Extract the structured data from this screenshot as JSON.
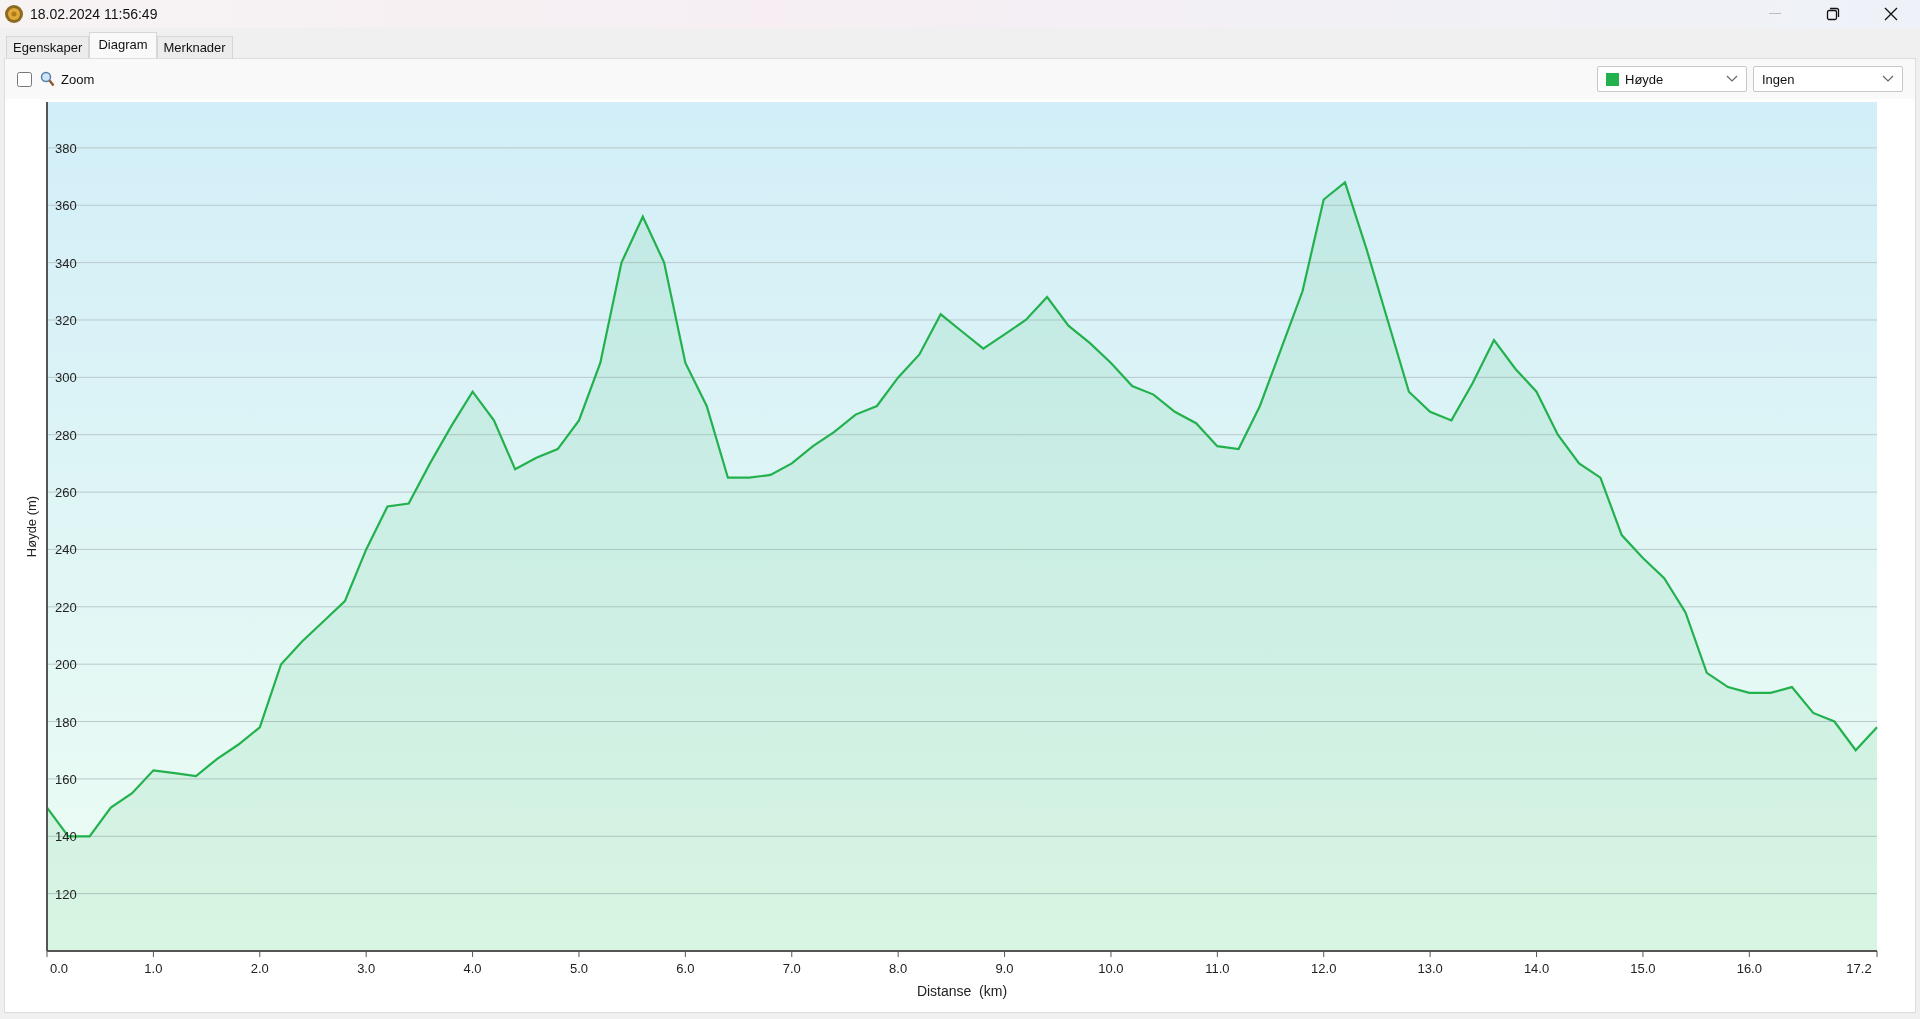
{
  "window": {
    "title": "18.02.2024 11:56:49"
  },
  "tabs": [
    {
      "label": "Egenskaper",
      "selected": false
    },
    {
      "label": "Diagram",
      "selected": true
    },
    {
      "label": "Merknader",
      "selected": false
    }
  ],
  "zoom": {
    "label": "Zoom",
    "checked": false
  },
  "selectors": [
    {
      "value": "Høyde",
      "color": "#22b14c"
    },
    {
      "value": "Ingen"
    }
  ],
  "chart": {
    "chart_data": {
      "type": "area",
      "xlabel": "Distanse  (km)",
      "ylabel": "Høyde (m)",
      "x": [
        0,
        0.2,
        0.4,
        0.6,
        0.8,
        1.0,
        1.2,
        1.4,
        1.6,
        1.8,
        2.0,
        2.2,
        2.4,
        2.6,
        2.8,
        3.0,
        3.2,
        3.4,
        3.6,
        3.8,
        4.0,
        4.2,
        4.4,
        4.6,
        4.8,
        5.0,
        5.2,
        5.4,
        5.6,
        5.8,
        6.0,
        6.2,
        6.4,
        6.6,
        6.8,
        7.0,
        7.2,
        7.4,
        7.6,
        7.8,
        8.0,
        8.2,
        8.4,
        8.6,
        8.8,
        9.0,
        9.2,
        9.4,
        9.6,
        9.8,
        10.0,
        10.2,
        10.4,
        10.6,
        10.8,
        11.0,
        11.2,
        11.4,
        11.6,
        11.8,
        12.0,
        12.2,
        12.4,
        12.6,
        12.8,
        13.0,
        13.2,
        13.4,
        13.6,
        13.8,
        14.0,
        14.2,
        14.4,
        14.6,
        14.8,
        15.0,
        15.2,
        15.4,
        15.6,
        15.8,
        16.0,
        16.2,
        16.4,
        16.6,
        16.8,
        17.0,
        17.2
      ],
      "grid": true,
      "series": [
        {
          "color": "#22b14c",
          "values": [
            150,
            140,
            140,
            150,
            155,
            163,
            162,
            161,
            167,
            172,
            178,
            200,
            208,
            215,
            222,
            240,
            255,
            256,
            270,
            283,
            295,
            285,
            268,
            272,
            275,
            285,
            305,
            340,
            356,
            340,
            305,
            290,
            265,
            265,
            266,
            270,
            276,
            281,
            287,
            290,
            300,
            308,
            322,
            316,
            310,
            315,
            320,
            328,
            318,
            312,
            305,
            297,
            294,
            288,
            284,
            276,
            275,
            290,
            310,
            330,
            362,
            368,
            345,
            320,
            295,
            288,
            285,
            298,
            313,
            303,
            295,
            280,
            270,
            265,
            245,
            237,
            230,
            218,
            197,
            192,
            190,
            190,
            192,
            183,
            180,
            170,
            178
          ]
        }
      ],
      "xlim": [
        0,
        17.2
      ],
      "ylim": [
        100,
        396
      ],
      "xticks": [
        {
          "value": 0,
          "label": "0.0"
        },
        {
          "value": 1,
          "label": "1.0"
        },
        {
          "value": 2,
          "label": "2.0"
        },
        {
          "value": 3,
          "label": "3.0"
        },
        {
          "value": 4,
          "label": "4.0"
        },
        {
          "value": 5,
          "label": "5.0"
        },
        {
          "value": 6,
          "label": "6.0"
        },
        {
          "value": 7,
          "label": "7.0"
        },
        {
          "value": 8,
          "label": "8.0"
        },
        {
          "value": 9,
          "label": "9.0"
        },
        {
          "value": 10,
          "label": "10.0"
        },
        {
          "value": 11,
          "label": "11.0"
        },
        {
          "value": 12,
          "label": "12.0"
        },
        {
          "value": 13,
          "label": "13.0"
        },
        {
          "value": 14,
          "label": "14.0"
        },
        {
          "value": 15,
          "label": "15.0"
        },
        {
          "value": 16,
          "label": "16.0"
        },
        {
          "value": 17.2,
          "label": "17.2"
        }
      ],
      "yticks": [
        120,
        140,
        160,
        180,
        200,
        220,
        240,
        260,
        280,
        300,
        320,
        340,
        360,
        380
      ]
    }
  }
}
